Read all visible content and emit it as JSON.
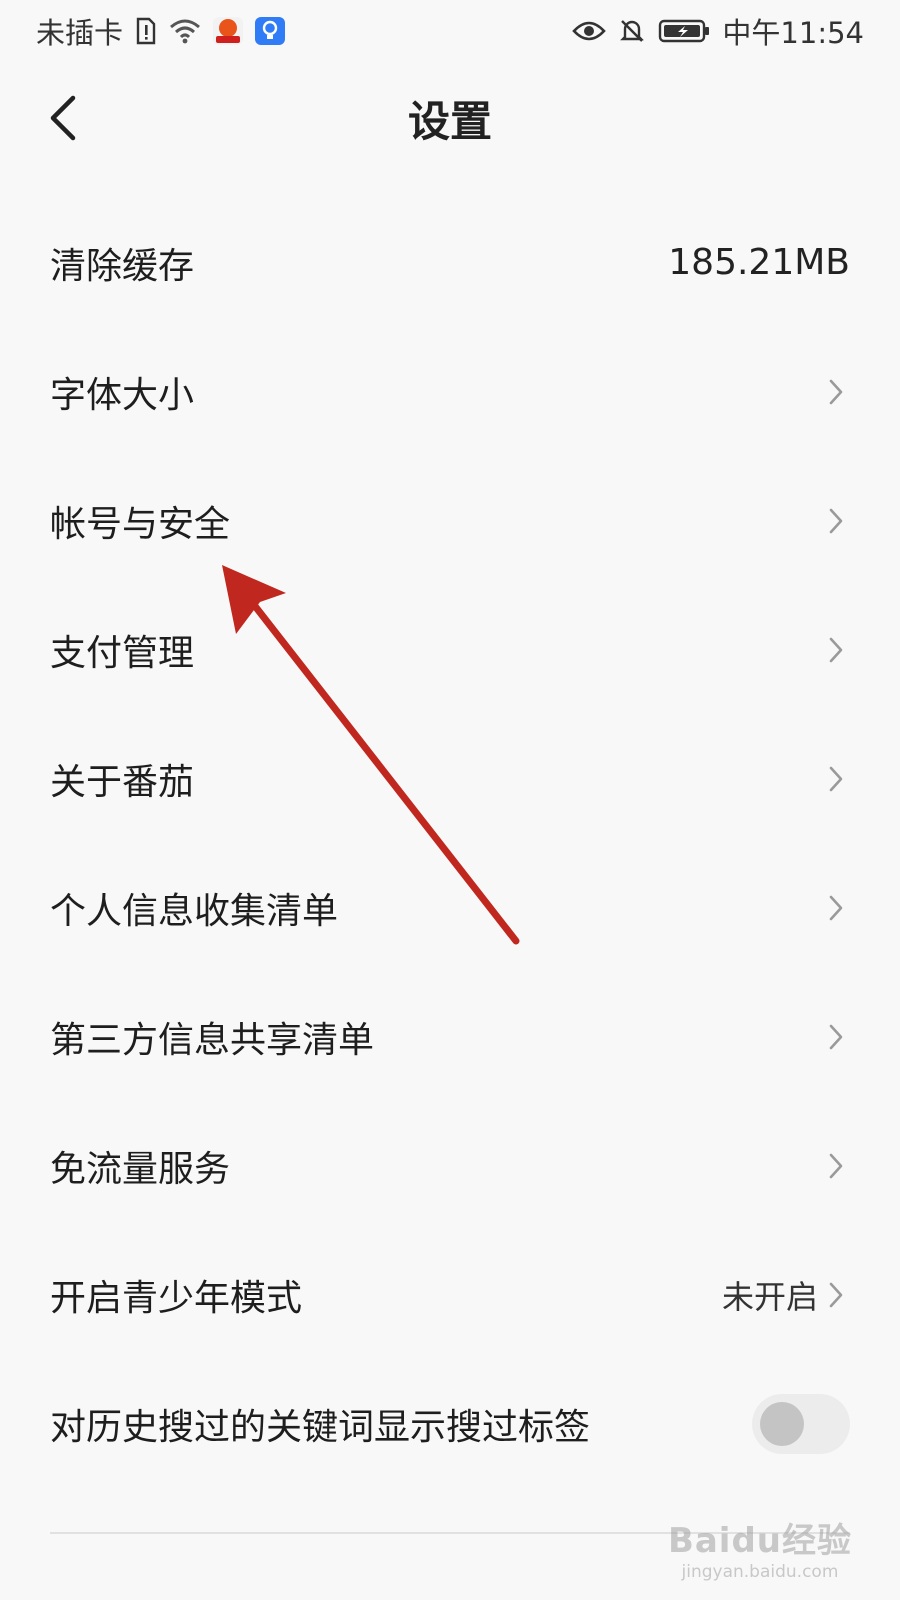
{
  "status_bar": {
    "carrier": "未插卡",
    "time": "中午11:54"
  },
  "header": {
    "title": "设置"
  },
  "settings": {
    "clear_cache": {
      "label": "清除缓存",
      "value": "185.21MB"
    },
    "font_size": {
      "label": "字体大小"
    },
    "account_security": {
      "label": "帐号与安全"
    },
    "payment": {
      "label": "支付管理"
    },
    "about": {
      "label": "关于番茄"
    },
    "personal_info_list": {
      "label": "个人信息收集清单"
    },
    "third_party_list": {
      "label": "第三方信息共享清单"
    },
    "free_data": {
      "label": "免流量服务"
    },
    "teen_mode": {
      "label": "开启青少年模式",
      "status": "未开启"
    },
    "search_tags": {
      "label": "对历史搜过的关键词显示搜过标签",
      "enabled": false
    }
  },
  "watermark": {
    "brand": "Baidu经验",
    "url": "jingyan.baidu.com"
  },
  "colors": {
    "background": "#f8f8f8",
    "annotation_arrow": "#c0281f",
    "toggle_off_track": "#ececec",
    "toggle_off_knob": "#c4c4c4"
  }
}
